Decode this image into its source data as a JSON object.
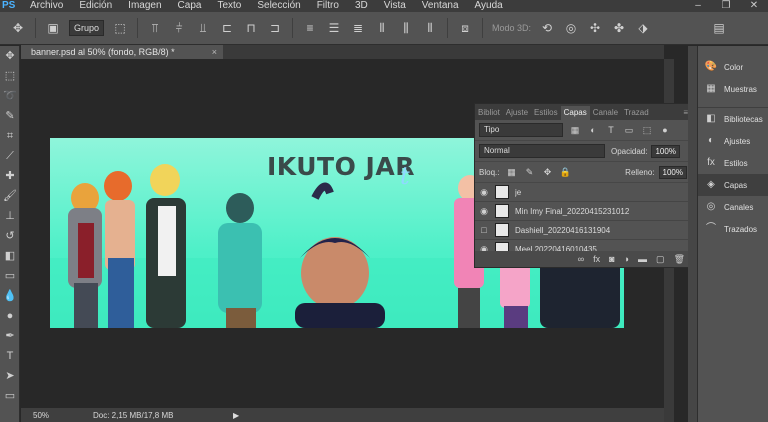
{
  "menu": {
    "logo": "PS",
    "items": [
      "Archivo",
      "Edición",
      "Imagen",
      "Capa",
      "Texto",
      "Selección",
      "Filtro",
      "3D",
      "Vista",
      "Ventana",
      "Ayuda"
    ]
  },
  "options_bar": {
    "group_select": "Grupo",
    "mode_3d_label": "Modo 3D:"
  },
  "document": {
    "tab_title": "banner.psd al 50% (fondo, RGB/8) *",
    "close": "×"
  },
  "canvas": {
    "title": "IKUTO JAR",
    "title_script": "t"
  },
  "status": {
    "zoom": "50%",
    "doc_info": "Doc: 2,15 MB/17,8 MB"
  },
  "layers_panel": {
    "tabs": [
      "Bibliot",
      "Ajuste",
      "Estilos",
      "Capas",
      "Canale",
      "Trazad"
    ],
    "active_tab": "Capas",
    "filter_select": "Tipo",
    "blend_mode": "Normal",
    "opacity_label": "Opacidad:",
    "opacity_value": "100%",
    "lock_label": "Bloq.:",
    "fill_label": "Relleno:",
    "fill_value": "100%",
    "layers": [
      {
        "name": "je",
        "visible": true
      },
      {
        "name": "Min Imy Final_20220415231012",
        "visible": true
      },
      {
        "name": "Dashiell_20220416131904",
        "visible": false
      },
      {
        "name": "Meel 20220416010435",
        "visible": true
      }
    ]
  },
  "dock": {
    "items": [
      {
        "label": "Color",
        "icon": "color-palette-icon"
      },
      {
        "label": "Muestras",
        "icon": "swatches-icon"
      },
      {
        "label": "Bibliotecas",
        "icon": "libraries-icon"
      },
      {
        "label": "Ajustes",
        "icon": "adjustments-icon"
      },
      {
        "label": "Estilos",
        "icon": "fx-styles-icon"
      },
      {
        "label": "Capas",
        "icon": "layers-icon"
      },
      {
        "label": "Canales",
        "icon": "channels-icon"
      },
      {
        "label": "Trazados",
        "icon": "paths-icon"
      }
    ]
  }
}
